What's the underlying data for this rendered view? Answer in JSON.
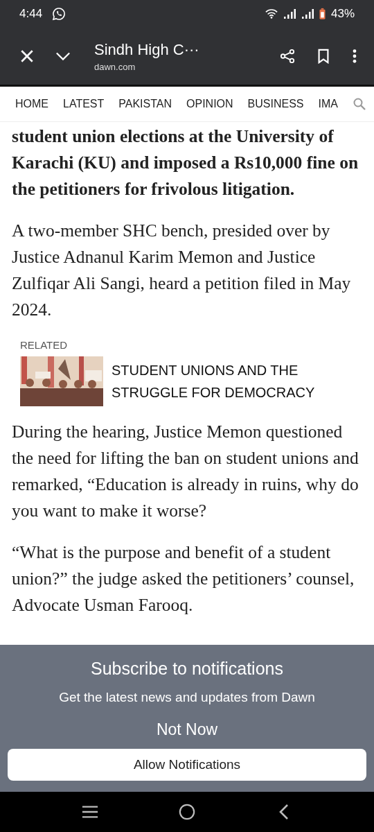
{
  "status_bar": {
    "time": "4:44",
    "battery": "43%"
  },
  "toolbar": {
    "title": "Sindh High C···",
    "domain": "dawn.com"
  },
  "nav": {
    "items": [
      "HOME",
      "LATEST",
      "PAKISTAN",
      "OPINION",
      "BUSINESS",
      "IMA"
    ]
  },
  "article": {
    "lead": "student union elections at the University of Karachi (KU) and imposed a Rs10,000 fine on the petitioners for frivolous litigation.",
    "paragraphs_before": [
      "A two-member SHC bench, presided over by Justice Adnanul Karim Memon and Justice Zulfiqar Ali Sangi, heard a petition filed in May 2024."
    ],
    "related": {
      "label": "RELATED",
      "title": "STUDENT UNIONS AND THE STRUGGLE FOR DEMOCRACY"
    },
    "paragraphs_after": [
      "During the hearing, Justice Memon questioned the need for lifting the ban on student unions and remarked, “Education is already in ruins, why do you want to make it worse?",
      "“What is the purpose and benefit of a student union?” the judge asked the petitioners’ counsel, Advocate Usman Farooq."
    ]
  },
  "banner": {
    "title": "Subscribe to notifications",
    "subtitle": "Get the latest news and updates from Dawn",
    "dismiss": "Not Now",
    "allow": "Allow Notifications"
  }
}
